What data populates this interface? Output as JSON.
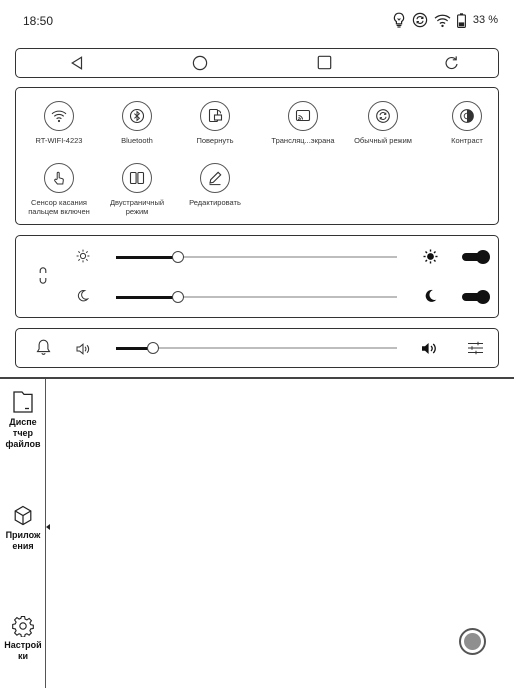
{
  "status_bar": {
    "time": "18:50",
    "battery": "33 %",
    "icons": [
      "lightbulb-icon",
      "sync-icon",
      "wifi-icon",
      "battery-icon"
    ]
  },
  "nav_bar": {
    "buttons": [
      "back-triangle-icon",
      "home-circle-icon",
      "recents-square-icon",
      "refresh-icon"
    ]
  },
  "quick_tiles": [
    {
      "label": "RT-WIFI-4223",
      "icon": "wifi-icon"
    },
    {
      "label": "Bluetooth",
      "icon": "bluetooth-icon"
    },
    {
      "label": "Повернуть",
      "icon": "rotate-icon"
    },
    {
      "label": "Трансляц...экрана",
      "icon": "cast-icon"
    },
    {
      "label": "Обычный режим",
      "icon": "refresh-mode-icon"
    },
    {
      "label": "Контраст",
      "icon": "contrast-icon"
    },
    {
      "label": "Сенсор касания пальцем включен",
      "icon": "touch-icon"
    },
    {
      "label": "Двустраничный режим",
      "icon": "split-page-icon"
    },
    {
      "label": "Редактировать",
      "icon": "pencil-icon"
    }
  ],
  "brightness": {
    "link_icon": "link-icon",
    "warm_light": {
      "icon_low": "sun-outline-icon",
      "icon_high": "sun-filled-icon",
      "level": 0.22,
      "enabled": true
    },
    "cold_light": {
      "icon_low": "moon-outline-icon",
      "icon_high": "moon-filled-icon",
      "level": 0.22,
      "enabled": true
    }
  },
  "volume": {
    "bell_icon": "bell-icon",
    "icon_low": "speaker-low-icon",
    "icon_high": "speaker-high-icon",
    "settings_icon": "sliders-icon",
    "level": 0.13
  },
  "sidebar": {
    "items": [
      {
        "label": "Диспе тчер файлов",
        "icon": "folder-icon"
      },
      {
        "label": "Прилож ения",
        "icon": "cube-icon"
      },
      {
        "label": "Настрой ки",
        "icon": "gear-icon"
      }
    ]
  },
  "floating_button": {
    "icon": "floating-ball-icon"
  }
}
